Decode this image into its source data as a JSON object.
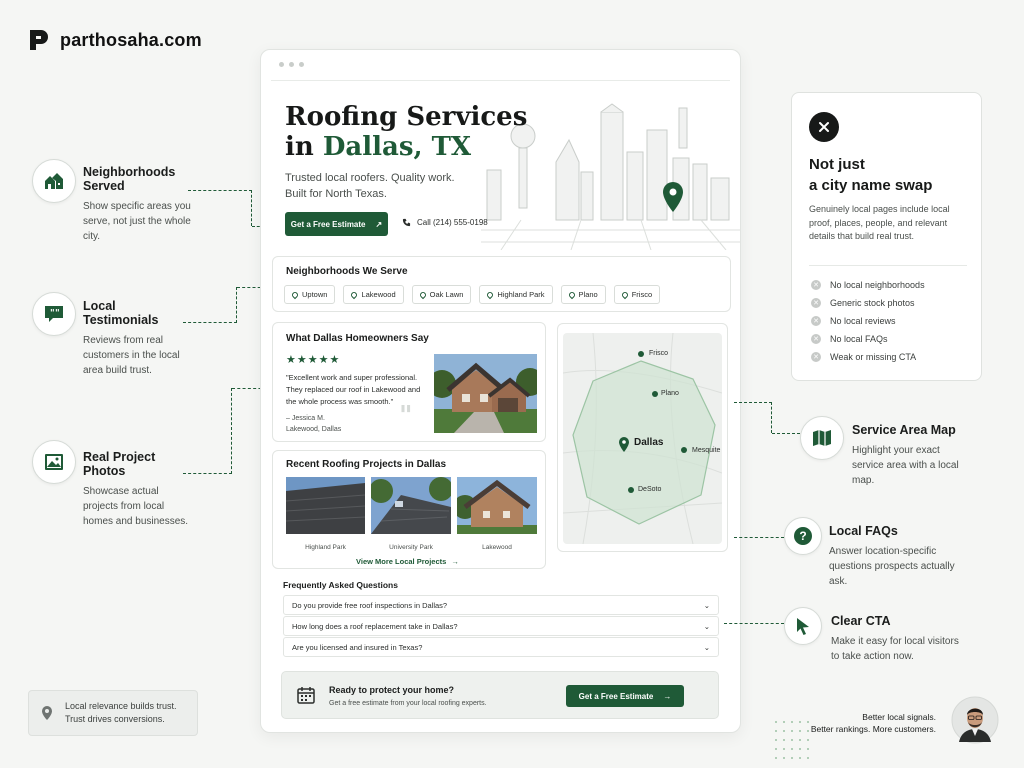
{
  "brand": {
    "name": "parthosaha.com"
  },
  "hero": {
    "title_line1": "Roofing Services",
    "title_prefix": "in ",
    "title_city": "Dallas, TX",
    "subtitle": "Trusted local roofers. Quality work. Built for North Texas.",
    "cta_label": "Get a Free Estimate",
    "phone": "Call (214) 555-0198"
  },
  "neighborhoods": {
    "title": "Neighborhoods We Serve",
    "items": [
      "Uptown",
      "Lakewood",
      "Oak Lawn",
      "Highland Park",
      "Plano",
      "Frisco"
    ]
  },
  "testimonials": {
    "title": "What Dallas Homeowners Say",
    "stars": "★★★★★",
    "quote": "\"Excellent work and super professional. They replaced our roof in Lakewood and the whole process was smooth.\"",
    "author": "– Jessica M.",
    "location": "Lakewood, Dallas",
    "rating": 5
  },
  "projects": {
    "title": "Recent Roofing Projects in Dallas",
    "items": [
      "Highland Park",
      "University Park",
      "Lakewood"
    ],
    "link_label": "View More Local Projects"
  },
  "map": {
    "labels": {
      "frisco": "Frisco",
      "plano": "Plano",
      "dallas": "Dallas",
      "mesquite": "Mesquite",
      "desoto": "DeSoto"
    }
  },
  "faq": {
    "title": "Frequently Asked Questions",
    "items": [
      "Do you provide free roof inspections in Dallas?",
      "How long does a roof replacement take in Dallas?",
      "Are you licensed and insured in Texas?"
    ]
  },
  "cta_bar": {
    "title": "Ready to protect your home?",
    "subtitle": "Get a free estimate from your local roofing experts.",
    "button": "Get a Free Estimate"
  },
  "callouts_left": [
    {
      "title": "Neighborhoods Served",
      "desc": "Show specific areas you serve, not just the whole city."
    },
    {
      "title": "Local Testimonials",
      "desc": "Reviews from real customers in the local area build trust."
    },
    {
      "title": "Real Project Photos",
      "desc": "Showcase actual projects from local homes and businesses."
    }
  ],
  "callouts_right": [
    {
      "title": "Service Area Map",
      "desc": "Highlight your exact service area with a local map."
    },
    {
      "title": "Local FAQs",
      "desc": "Answer location-specific questions prospects actually ask."
    },
    {
      "title": "Clear CTA",
      "desc": "Make it easy for local visitors to take action now."
    }
  ],
  "info_card": {
    "title_line1": "Not just",
    "title_line2": "a city name swap",
    "desc": "Genuinely local pages include local proof, places, people, and relevant details that build real trust.",
    "items": [
      "No local neighborhoods",
      "Generic stock photos",
      "No local reviews",
      "No local FAQs",
      "Weak or missing CTA"
    ]
  },
  "footer": {
    "left_line1": "Local relevance builds trust.",
    "left_line2": "Trust drives conversions.",
    "right_line1": "Better local signals.",
    "right_line2": "Better rankings. More customers."
  },
  "colors": {
    "accent": "#1f5a37",
    "background": "#f5f6f4"
  },
  "icons": {
    "brand": "brand-logo-icon",
    "neighborhoods": "houses-icon",
    "testimonials": "chat-bubble-icon",
    "photos": "image-icon",
    "map": "map-icon",
    "faq": "question-icon",
    "cta": "cursor-icon",
    "close": "close-icon",
    "pin": "location-pin-icon",
    "calendar": "calendar-icon",
    "phone": "phone-icon"
  }
}
